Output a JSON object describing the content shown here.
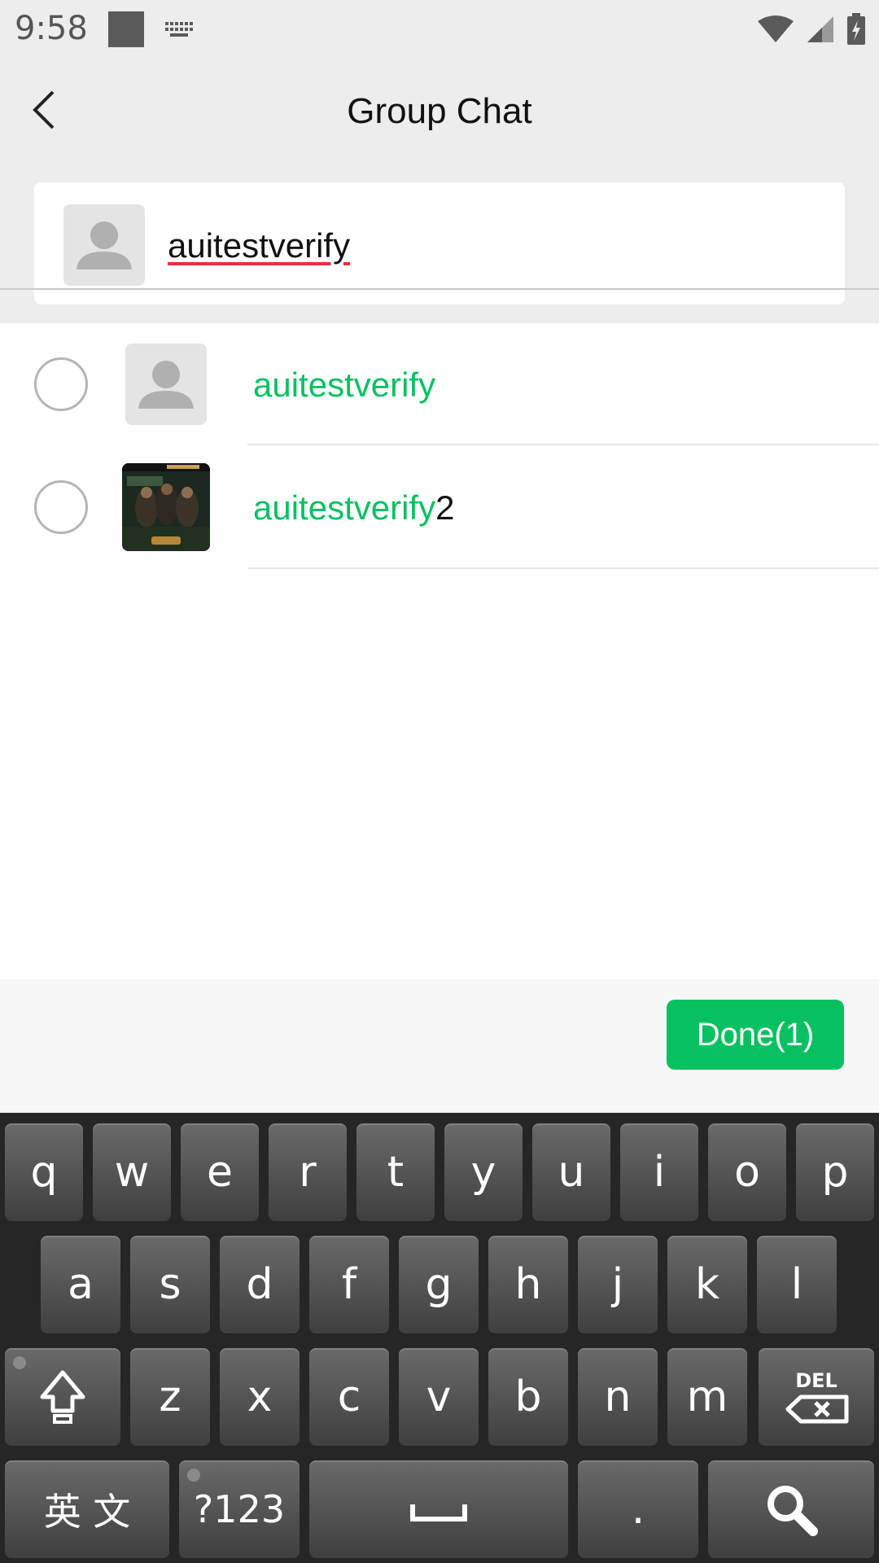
{
  "status_bar": {
    "time": "9:58"
  },
  "header": {
    "title": "Group Chat"
  },
  "search": {
    "query": "auitestverify"
  },
  "results": [
    {
      "match": "auitestverify",
      "rest": "",
      "avatar": "default-avatar",
      "selected": false
    },
    {
      "match": "auitestverify",
      "rest": "2",
      "avatar": "photo-avatar",
      "selected": false
    }
  ],
  "actions": {
    "done_label": "Done(1)"
  },
  "keyboard": {
    "row1": [
      "q",
      "w",
      "e",
      "r",
      "t",
      "y",
      "u",
      "i",
      "o",
      "p"
    ],
    "row2": [
      "a",
      "s",
      "d",
      "f",
      "g",
      "h",
      "j",
      "k",
      "l"
    ],
    "row3": [
      "z",
      "x",
      "c",
      "v",
      "b",
      "n",
      "m"
    ],
    "lang_label": "英 文",
    "symbols_label": "?123",
    "period_label": "."
  },
  "colors": {
    "accent": "#07c160",
    "background": "#ededed",
    "keyboard": "#262626"
  }
}
